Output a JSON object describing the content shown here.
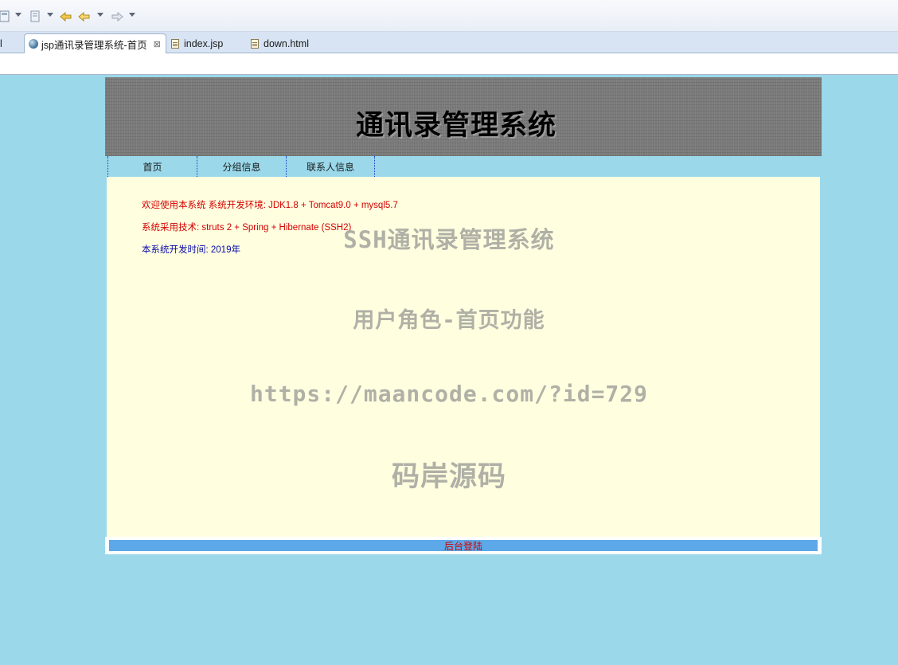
{
  "ide": {
    "tabs": [
      {
        "label": "jsp通讯录管理系统-首页",
        "active": true
      },
      {
        "label": "index.jsp",
        "active": false
      },
      {
        "label": "down.html",
        "active": false
      }
    ],
    "tab_left_stub": "l",
    "close_glyph": "⊠"
  },
  "page": {
    "banner_title": "通讯录管理系统",
    "nav": [
      "首页",
      "分组信息",
      "联系人信息"
    ],
    "lines": [
      {
        "text": "欢迎使用本系统 系统开发环境: JDK1.8 + Tomcat9.0 + mysql5.7",
        "color": "#d40000"
      },
      {
        "text": "系统采用技术: struts 2 + Spring + Hibernate (SSH2)",
        "color": "#d40000"
      },
      {
        "label": "本系统开发时间: ",
        "value": "2019年",
        "color": "#0a0aaa"
      }
    ],
    "footer_link": "后台登陆"
  },
  "watermark": {
    "line1": "SSH通讯录管理系统",
    "line2": "用户角色-首页功能",
    "line3": "https://maancode.com/?id=729",
    "line4": "码岸源码"
  },
  "colors": {
    "background": "#9ad8ea",
    "content_bg": "#ffffe0",
    "banner_bg": "#7a7a7a",
    "footer_bar": "#5ca8e8"
  }
}
